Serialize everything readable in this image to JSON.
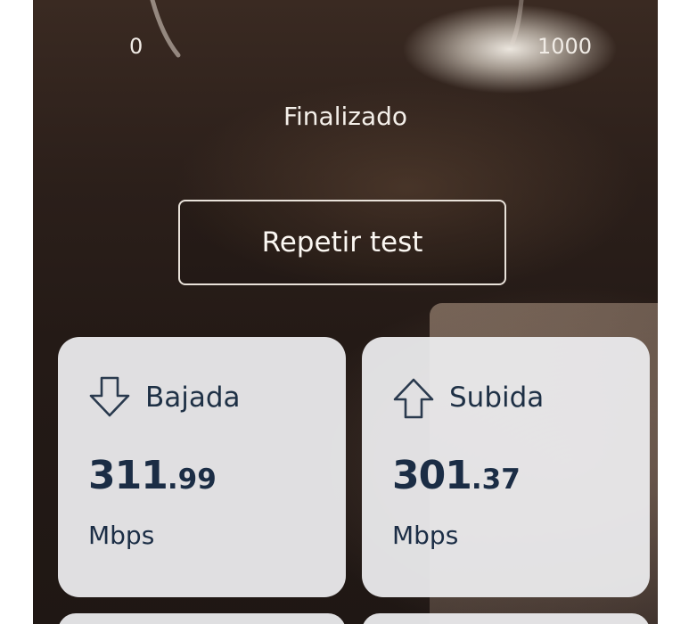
{
  "gauge": {
    "min_label": "0",
    "max_label": "1000"
  },
  "status": "Finalizado",
  "repeat_button": "Repetir test",
  "results": {
    "download": {
      "label": "Bajada",
      "value_int": "311",
      "value_dec": ".99",
      "unit": "Mbps",
      "icon": "arrow-down-icon"
    },
    "upload": {
      "label": "Subida",
      "value_int": "301",
      "value_dec": ".37",
      "unit": "Mbps",
      "icon": "arrow-up-icon"
    }
  },
  "colors": {
    "card_text": "#1b2d45",
    "card_bg": "#ececee",
    "overlay_text": "#f4efe9"
  }
}
